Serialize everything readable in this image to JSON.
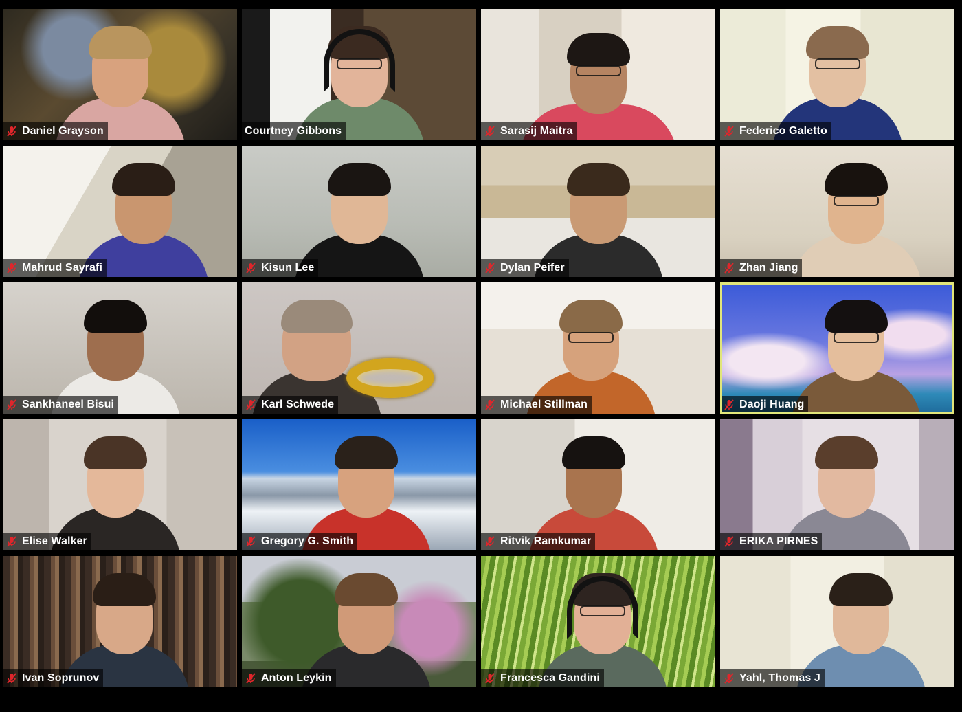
{
  "window": {
    "view": "gallery"
  },
  "colors": {
    "background": "#000000",
    "nameplate_bg": "rgba(0,0,0,0.62)",
    "name_text": "#ffffff",
    "muted_icon": "#e0262b",
    "active_speaker_border": "#e1e67a"
  },
  "participants": [
    {
      "name": "Daniel Grayson",
      "muted": true,
      "active": false,
      "icon": "muted-mic-icon"
    },
    {
      "name": "Courtney Gibbons",
      "muted": false,
      "active": false,
      "icon": ""
    },
    {
      "name": "Sarasij Maitra",
      "muted": true,
      "active": false,
      "icon": "muted-mic-icon"
    },
    {
      "name": "Federico Galetto",
      "muted": true,
      "active": false,
      "icon": "muted-mic-icon"
    },
    {
      "name": "Mahrud Sayrafi",
      "muted": true,
      "active": false,
      "icon": "muted-mic-icon"
    },
    {
      "name": "Kisun Lee",
      "muted": true,
      "active": false,
      "icon": "muted-mic-icon"
    },
    {
      "name": "Dylan Peifer",
      "muted": true,
      "active": false,
      "icon": "muted-mic-icon"
    },
    {
      "name": "Zhan Jiang",
      "muted": true,
      "active": false,
      "icon": "muted-mic-icon"
    },
    {
      "name": "Sankhaneel Bisui",
      "muted": true,
      "active": false,
      "icon": "muted-mic-icon"
    },
    {
      "name": "Karl Schwede",
      "muted": true,
      "active": false,
      "icon": "muted-mic-icon"
    },
    {
      "name": "Michael Stillman",
      "muted": true,
      "active": false,
      "icon": "muted-mic-icon"
    },
    {
      "name": "Daoji Huang",
      "muted": true,
      "active": true,
      "icon": "muted-mic-icon"
    },
    {
      "name": "Elise Walker",
      "muted": true,
      "active": false,
      "icon": "muted-mic-icon"
    },
    {
      "name": "Gregory G. Smith",
      "muted": true,
      "active": false,
      "icon": "muted-mic-icon"
    },
    {
      "name": "Ritvik Ramkumar",
      "muted": true,
      "active": false,
      "icon": "muted-mic-icon"
    },
    {
      "name": "ERIKA PIRNES",
      "muted": true,
      "active": false,
      "icon": "muted-mic-icon"
    },
    {
      "name": "Ivan Soprunov",
      "muted": true,
      "active": false,
      "icon": "muted-mic-icon"
    },
    {
      "name": "Anton Leykin",
      "muted": true,
      "active": false,
      "icon": "muted-mic-icon"
    },
    {
      "name": "Francesca Gandini",
      "muted": true,
      "active": false,
      "icon": "muted-mic-icon"
    },
    {
      "name": "Yahl, Thomas J",
      "muted": true,
      "active": false,
      "icon": "muted-mic-icon"
    }
  ]
}
